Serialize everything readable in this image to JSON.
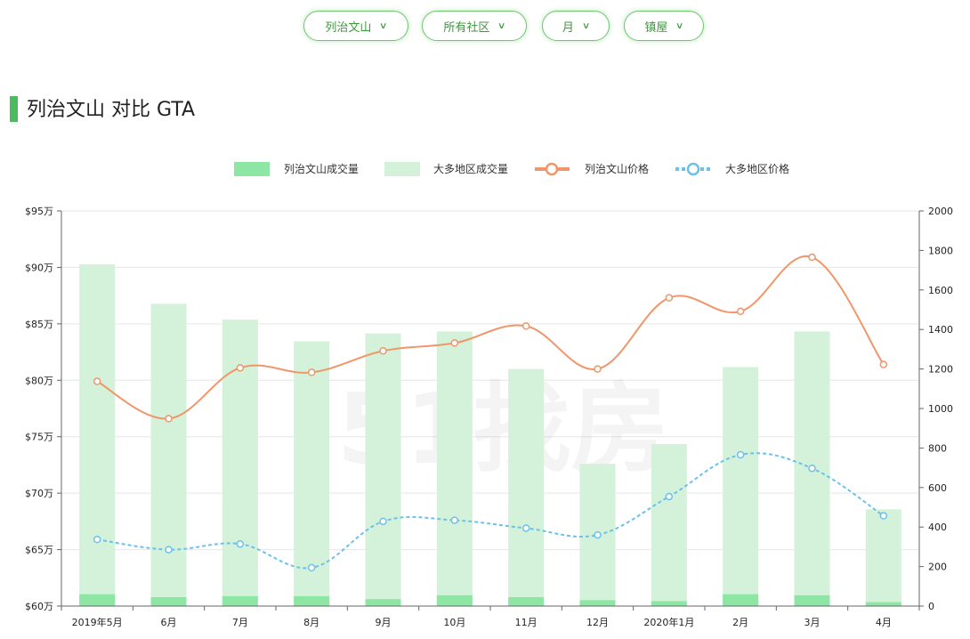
{
  "filters": [
    {
      "label": "列治文山"
    },
    {
      "label": "所有社区"
    },
    {
      "label": "月"
    },
    {
      "label": "镇屋"
    }
  ],
  "page_title": "列治文山 对比 GTA",
  "watermark": "51找房",
  "colors": {
    "accent": "#4cbb5e",
    "local_volume": "#8ee6a4",
    "gta_volume": "#d4f2d9",
    "local_price": "#f0966a",
    "gta_price": "#6cc0ea"
  },
  "chart_data": {
    "type": "bar+line",
    "categories": [
      "2019年5月",
      "6月",
      "7月",
      "8月",
      "9月",
      "10月",
      "11月",
      "12月",
      "2020年1月",
      "2月",
      "3月",
      "4月"
    ],
    "left_axis": {
      "min": 60,
      "max": 95,
      "step": 5,
      "tick_labels": [
        "$60万",
        "$65万",
        "$70万",
        "$75万",
        "$80万",
        "$85万",
        "$90万",
        "$95万"
      ]
    },
    "right_axis": {
      "min": 0,
      "max": 2000,
      "step": 200,
      "tick_labels": [
        "0",
        "200",
        "400",
        "600",
        "800",
        "1000",
        "1200",
        "1400",
        "1600",
        "1800",
        "2000"
      ]
    },
    "series": [
      {
        "name": "列治文山成交量",
        "type": "bar",
        "axis": "right",
        "values": [
          60,
          45,
          50,
          50,
          35,
          55,
          45,
          30,
          25,
          60,
          55,
          20
        ]
      },
      {
        "name": "大多地区成交量",
        "type": "bar",
        "axis": "right",
        "values": [
          1730,
          1530,
          1450,
          1340,
          1380,
          1390,
          1200,
          720,
          820,
          1210,
          1390,
          490
        ]
      },
      {
        "name": "列治文山价格",
        "type": "line",
        "axis": "left",
        "values": [
          79.9,
          76.6,
          81.1,
          80.7,
          82.6,
          83.3,
          84.8,
          81.0,
          87.3,
          86.1,
          90.9,
          81.4
        ]
      },
      {
        "name": "大多地区价格",
        "type": "line",
        "axis": "left",
        "dashed": true,
        "values": [
          65.9,
          65.0,
          65.5,
          63.4,
          67.5,
          67.6,
          66.9,
          66.3,
          69.7,
          73.4,
          72.2,
          68.0
        ]
      }
    ],
    "legend": "top-center",
    "grid": true
  }
}
